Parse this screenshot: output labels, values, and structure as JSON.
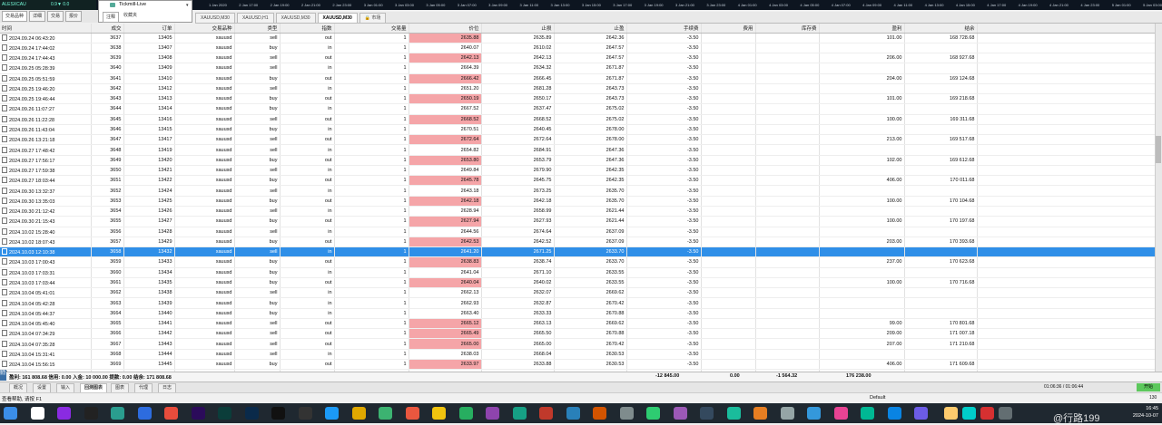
{
  "account": {
    "name": "Tickmill-Live"
  },
  "price_box": {
    "text1": "ALESXCAU",
    "text2": "0.9▼  0.0"
  },
  "time_axis": [
    "1 Jan 2020",
    "2 Jan 17:00",
    "2 Jan 19:00",
    "2 Jan 21:00",
    "2 Jan 23:00",
    "3 Jan 01:00",
    "3 Jan 03:00",
    "3 Jan 05:00",
    "3 Jan 07:00",
    "3 Jan 09:00",
    "3 Jan 11:00",
    "3 Jan 13:00",
    "3 Jan 15:00",
    "3 Jan 17:00",
    "3 Jan 19:00",
    "3 Jan 21:00",
    "3 Jan 23:00",
    "4 Jan 01:00",
    "4 Jan 03:00",
    "4 Jan 05:00",
    "4 Jan 07:00",
    "4 Jan 09:00",
    "4 Jan 11:00",
    "4 Jan 13:00",
    "4 Jan 15:00",
    "4 Jan 17:00",
    "4 Jan 19:00",
    "4 Jan 21:00",
    "4 Jan 23:00",
    "5 Jan 01:00",
    "5 Jan 03:00"
  ],
  "nav_tabs": [
    "交易品种",
    "详细",
    "交易",
    "报价"
  ],
  "fav_tabs": [
    "注释",
    "收藏夹"
  ],
  "chart_tabs": [
    {
      "label": "XAUUSD,M30",
      "active": false
    },
    {
      "label": "XAUUSD,H1",
      "active": false
    },
    {
      "label": "XAUUSD,M30",
      "active": false
    },
    {
      "label": "XAUUSD,M30",
      "active": true
    },
    {
      "label": "市场",
      "active": false
    }
  ],
  "table": {
    "headers": [
      "时间",
      "成交",
      "订单",
      "交易品种",
      "类型",
      "指数",
      "交易量",
      "价位",
      "止损",
      "止盈",
      "手续费",
      "费用",
      "库存费",
      "盈利",
      "结余",
      "注释"
    ],
    "rows": [
      [
        "2024.09.24 06:43:20",
        "3637",
        "13405",
        "xauusd",
        "sell",
        "out",
        "1",
        "2635.88",
        "2635.89",
        "2642.36",
        "-3.50",
        "",
        "",
        "101.00",
        "168 728.68",
        "sl 2635.89"
      ],
      [
        "2024.09.24 17:44:02",
        "3638",
        "13407",
        "xauusd",
        "buy",
        "in",
        "1",
        "2640.07",
        "2610.02",
        "2647.57",
        "-3.50",
        "",
        "",
        "",
        "",
        "MAXGOLD(#6)"
      ],
      [
        "2024.09.24 17:44:43",
        "3639",
        "13408",
        "xauusd",
        "sell",
        "out",
        "1",
        "2642.13",
        "2642.13",
        "2647.57",
        "-3.50",
        "",
        "",
        "206.00",
        "168 927.68",
        "sl 2642.13"
      ],
      [
        "2024.09.25 05:28:39",
        "3640",
        "13409",
        "xauusd",
        "sell",
        "in",
        "1",
        "2664.39",
        "2634.32",
        "2671.87",
        "-3.50",
        "",
        "",
        "",
        "",
        "MAXGOLD(#5)"
      ],
      [
        "2024.09.25 05:51:59",
        "3641",
        "13410",
        "xauusd",
        "buy",
        "out",
        "1",
        "2666.42",
        "2666.45",
        "2671.87",
        "-3.50",
        "",
        "",
        "204.00",
        "169 124.68",
        "sl 2666.45"
      ],
      [
        "2024.09.25 19:46:20",
        "3642",
        "13412",
        "xauusd",
        "sell",
        "in",
        "1",
        "2651.20",
        "2681.28",
        "2643.73",
        "-3.50",
        "",
        "",
        "",
        "",
        "MAXGOLD(#4)"
      ],
      [
        "2024.09.25 19:46:44",
        "3643",
        "13413",
        "xauusd",
        "buy",
        "out",
        "1",
        "2650.19",
        "2650.17",
        "2643.73",
        "-3.50",
        "",
        "",
        "101.00",
        "169 218.68",
        "sl 2650.17"
      ],
      [
        "2024.09.26 11:07:27",
        "3644",
        "13414",
        "xauusd",
        "buy",
        "in",
        "1",
        "2667.52",
        "2637.47",
        "2675.02",
        "-3.50",
        "",
        "",
        "",
        "",
        "MAXGOLD(#3)"
      ],
      [
        "2024.09.26 11:22:28",
        "3645",
        "13416",
        "xauusd",
        "sell",
        "out",
        "1",
        "2668.52",
        "2668.52",
        "2675.02",
        "-3.50",
        "",
        "",
        "100.00",
        "169 311.68",
        "sl 2668.52"
      ],
      [
        "2024.09.26 11:43:04",
        "3646",
        "13415",
        "xauusd",
        "buy",
        "in",
        "1",
        "2670.51",
        "2640.45",
        "2678.00",
        "-3.50",
        "",
        "",
        "",
        "",
        "MAXGOLD(#4)"
      ],
      [
        "2024.09.26 13:21:18",
        "3647",
        "13417",
        "xauusd",
        "sell",
        "out",
        "1",
        "2672.64",
        "2672.64",
        "2678.00",
        "-3.50",
        "",
        "",
        "213.00",
        "169 517.68",
        "sl 2672.64"
      ],
      [
        "2024.09.27 17:48:42",
        "3648",
        "13419",
        "xauusd",
        "sell",
        "in",
        "1",
        "2654.82",
        "2684.91",
        "2647.36",
        "-3.50",
        "",
        "",
        "",
        "",
        "MAXGOLD(#1)"
      ],
      [
        "2024.09.27 17:56:17",
        "3649",
        "13420",
        "xauusd",
        "buy",
        "out",
        "1",
        "2653.80",
        "2653.79",
        "2647.36",
        "-3.50",
        "",
        "",
        "102.00",
        "169 612.68",
        "sl 2653.79"
      ],
      [
        "2024.09.27 17:59:38",
        "3650",
        "13421",
        "xauusd",
        "sell",
        "in",
        "1",
        "2649.84",
        "2679.90",
        "2642.35",
        "-3.50",
        "",
        "",
        "",
        "",
        "MAXGOLD(#3)"
      ],
      [
        "2024.09.27 18:03:44",
        "3651",
        "13422",
        "xauusd",
        "buy",
        "out",
        "1",
        "2645.78",
        "2645.75",
        "2642.35",
        "-3.50",
        "",
        "",
        "406.00",
        "170 011.68",
        "sl 2645.75"
      ],
      [
        "2024.09.30 13:32:37",
        "3652",
        "13424",
        "xauusd",
        "sell",
        "in",
        "1",
        "2643.18",
        "2673.25",
        "2635.70",
        "-3.50",
        "",
        "",
        "",
        "",
        "MAXGOLD(#4)"
      ],
      [
        "2024.09.30 13:35:03",
        "3653",
        "13425",
        "xauusd",
        "buy",
        "out",
        "1",
        "2642.18",
        "2642.18",
        "2635.70",
        "-3.50",
        "",
        "",
        "100.00",
        "170 104.68",
        "sl 2642.18"
      ],
      [
        "2024.09.30 21:12:42",
        "3654",
        "13426",
        "xauusd",
        "sell",
        "in",
        "1",
        "2628.94",
        "2658.99",
        "2621.44",
        "-3.50",
        "",
        "",
        "",
        "",
        "MAXGOLD(#8)"
      ],
      [
        "2024.09.30 21:15:43",
        "3655",
        "13427",
        "xauusd",
        "buy",
        "out",
        "1",
        "2627.94",
        "2627.93",
        "2621.44",
        "-3.50",
        "",
        "",
        "100.00",
        "170 197.68",
        "sl 2627.93"
      ],
      [
        "2024.10.02 15:28:40",
        "3656",
        "13428",
        "xauusd",
        "sell",
        "in",
        "1",
        "2644.56",
        "2674.64",
        "2637.09",
        "-3.50",
        "",
        "",
        "",
        "",
        "MAXGOLD(#6)"
      ],
      [
        "2024.10.02 18:07:43",
        "3657",
        "13429",
        "xauusd",
        "buy",
        "out",
        "1",
        "2642.53",
        "2642.52",
        "2637.09",
        "-3.50",
        "",
        "",
        "203.00",
        "170 393.68",
        "sl 2642.52"
      ],
      [
        "2024.10.03 12:10:38",
        "3658",
        "13432",
        "xauusd",
        "sell",
        "in",
        "1",
        "2641.20",
        "2671.25",
        "2633.70",
        "-3.50",
        "",
        "",
        "",
        "",
        "MAXGOLD(#5)"
      ],
      [
        "2024.10.03 17:00:43",
        "3659",
        "13433",
        "xauusd",
        "buy",
        "out",
        "1",
        "2638.83",
        "2638.74",
        "2633.70",
        "-3.50",
        "",
        "",
        "237.00",
        "170 623.68",
        "sl 2638.74"
      ],
      [
        "2024.10.03 17:03:31",
        "3660",
        "13434",
        "xauusd",
        "buy",
        "in",
        "1",
        "2641.04",
        "2671.10",
        "2633.55",
        "-3.50",
        "",
        "",
        "",
        "",
        "MAXGOLD(#4)"
      ],
      [
        "2024.10.03 17:03:44",
        "3661",
        "13435",
        "xauusd",
        "buy",
        "out",
        "1",
        "2640.04",
        "2640.02",
        "2633.55",
        "-3.50",
        "",
        "",
        "100.00",
        "170 716.68",
        "sl 2640.02"
      ],
      [
        "2024.10.04 05:41:01",
        "3662",
        "13438",
        "xauusd",
        "sell",
        "in",
        "1",
        "2662.13",
        "2632.07",
        "2669.62",
        "-3.50",
        "",
        "",
        "",
        "",
        "MAXGOLD(#3)"
      ],
      [
        "2024.10.04 05:42:28",
        "3663",
        "13439",
        "xauusd",
        "buy",
        "in",
        "1",
        "2662.93",
        "2632.87",
        "2670.42",
        "-3.50",
        "",
        "",
        "",
        "",
        "MAXGOLD(#2)"
      ],
      [
        "2024.10.04 05:44:37",
        "3664",
        "13440",
        "xauusd",
        "buy",
        "in",
        "1",
        "2663.40",
        "2633.33",
        "2670.88",
        "-3.50",
        "",
        "",
        "",
        "",
        "MAXGOLD(#5)"
      ],
      [
        "2024.10.04 05:45:40",
        "3665",
        "13441",
        "xauusd",
        "sell",
        "out",
        "1",
        "2665.12",
        "2663.13",
        "2669.62",
        "-3.50",
        "",
        "",
        "99.00",
        "170 801.68",
        "sl 2663.13"
      ],
      [
        "2024.10.04 07:34:29",
        "3666",
        "13442",
        "xauusd",
        "sell",
        "out",
        "1",
        "2665.49",
        "2665.50",
        "2670.88",
        "-3.50",
        "",
        "",
        "209.00",
        "171 007.18",
        "sl 2665.50"
      ],
      [
        "2024.10.04 07:35:28",
        "3667",
        "13443",
        "xauusd",
        "sell",
        "out",
        "1",
        "2665.00",
        "2665.00",
        "2670.42",
        "-3.50",
        "",
        "",
        "207.00",
        "171 210.68",
        "sl 2665.00"
      ],
      [
        "2024.10.04 15:31:41",
        "3668",
        "13444",
        "xauusd",
        "sell",
        "in",
        "1",
        "2638.03",
        "2668.04",
        "2630.53",
        "-3.50",
        "",
        "",
        "",
        "",
        "MAXGOLD(#4)"
      ],
      [
        "2024.10.04 15:56:15",
        "3669",
        "13445",
        "xauusd",
        "buy",
        "out",
        "1",
        "2633.97",
        "2633.88",
        "2630.53",
        "-3.50",
        "",
        "",
        "406.00",
        "171 609.68",
        "sl 2633.88"
      ],
      [
        "2024.10.04 18:10:14",
        "3670",
        "13446",
        "xauusd",
        "buy",
        "in",
        "1",
        "2667.91",
        "2637.84",
        "2675.39",
        "-3.50",
        "",
        "",
        "",
        "",
        "MAXGOLD(#3)"
      ],
      [
        "2024.10.04 18:13:17",
        "3671",
        "13447",
        "xauusd",
        "sell",
        "out",
        "1",
        "2669.97",
        "2669.97",
        "2675.39",
        "-3.50",
        "",
        "",
        "206.00",
        "171 808.68",
        "sl 2669.97"
      ]
    ],
    "highlight_rows": [
      0,
      2,
      4,
      6,
      8,
      10,
      12,
      14,
      16,
      18,
      20,
      22,
      24,
      28,
      29,
      30,
      32,
      34
    ],
    "selected_row": 21
  },
  "summary": {
    "left": "盈利: 161 808.68  信用: 0.00  入金: 10 000.00  提款: 0.00  结余: 171 808.68",
    "commission": "-12 845.00",
    "fee": "0.00",
    "swap": "-1 564.32",
    "profit": "176 238.00"
  },
  "bottom_tabs": [
    "概况",
    "设置",
    "输入",
    "回测图表",
    "图表",
    "代理",
    "日志"
  ],
  "bottom_active": 3,
  "time_info": "01:06:36 / 01:06:44",
  "start_label": "开始",
  "side_label": "策略测试",
  "status": {
    "hint": "查看帮助, 请按 F1",
    "profile": "Default",
    "num": "130"
  },
  "clock": {
    "time": "16:45",
    "date": "2024-10-07"
  },
  "watermark": "@行路199",
  "colors": {
    "highlight": "#f5a5a8",
    "selected": "#2f8fe8",
    "taskbar": "#1f2830",
    "start": "#5cc85c"
  },
  "taskbar_icons": [
    "window-icon",
    "search-icon",
    "app-icon",
    "app-icon",
    "app-icon",
    "app-icon",
    "chrome-icon",
    "premiere-icon",
    "audition-icon",
    "photoshop-icon",
    "capcut-icon",
    "terminal-icon",
    "qq-icon",
    "folder-icon",
    "app-icon",
    "app-icon",
    "app-icon",
    "app-icon",
    "app-icon",
    "app-icon",
    "app-icon",
    "app-icon",
    "app-icon",
    "app-icon",
    "app-icon",
    "app-icon",
    "app-icon",
    "app-icon",
    "app-icon",
    "app-icon",
    "app-icon",
    "app-icon",
    "app-icon",
    "app-icon",
    "app-icon",
    "app-icon",
    "app-icon",
    "app-icon",
    "app-icon"
  ]
}
